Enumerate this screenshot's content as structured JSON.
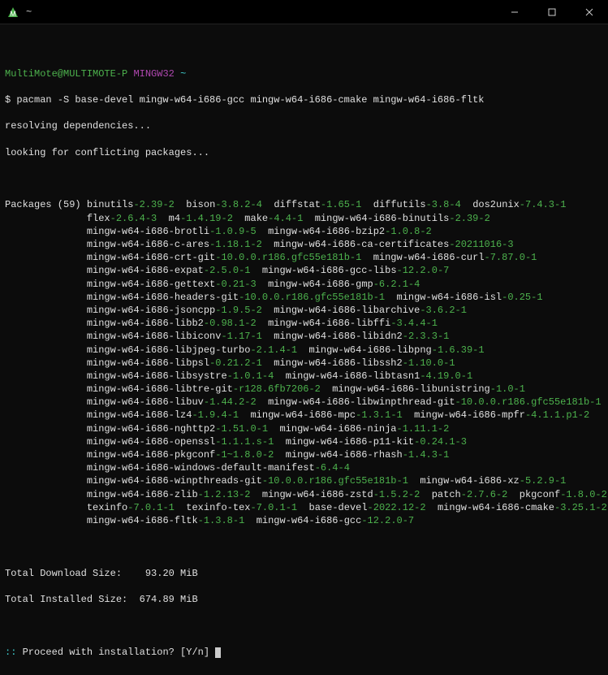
{
  "titlebar": {
    "title": "~"
  },
  "prompt": {
    "user": "MultiMote@MULTIMOTE-P",
    "env": "MINGW32",
    "tilde": "~",
    "dollar": "$",
    "command": "pacman -S base-devel mingw-w64-i686-gcc mingw-w64-i686-cmake mingw-w64-i686-fltk"
  },
  "lines": {
    "resolving": "resolving dependencies...",
    "looking": "looking for conflicting packages...",
    "packages_label": "Packages (59)",
    "total_dl_label": "Total Download Size:",
    "total_dl_val": "93.20 MiB",
    "total_inst_label": "Total Installed Size:",
    "total_inst_val": "674.89 MiB",
    "proceed_prefix": ":: ",
    "proceed_text": "Proceed with installation? [Y/n] "
  },
  "packages": [
    [
      [
        "binutils",
        "2.39-2"
      ],
      [
        "bison",
        "3.8.2-4"
      ],
      [
        "diffstat",
        "1.65-1"
      ],
      [
        "diffutils",
        "3.8-4"
      ],
      [
        "dos2unix",
        "7.4.3-1"
      ]
    ],
    [
      [
        "flex",
        "2.6.4-3"
      ],
      [
        "m4",
        "1.4.19-2"
      ],
      [
        "make",
        "4.4-1"
      ],
      [
        "mingw-w64-i686-binutils",
        "2.39-2"
      ]
    ],
    [
      [
        "mingw-w64-i686-brotli",
        "1.0.9-5"
      ],
      [
        "mingw-w64-i686-bzip2",
        "1.0.8-2"
      ]
    ],
    [
      [
        "mingw-w64-i686-c-ares",
        "1.18.1-2"
      ],
      [
        "mingw-w64-i686-ca-certificates",
        "20211016-3"
      ]
    ],
    [
      [
        "mingw-w64-i686-crt-git",
        "10.0.0.r186.gfc55e181b-1"
      ],
      [
        "mingw-w64-i686-curl",
        "7.87.0-1"
      ]
    ],
    [
      [
        "mingw-w64-i686-expat",
        "2.5.0-1"
      ],
      [
        "mingw-w64-i686-gcc-libs",
        "12.2.0-7"
      ]
    ],
    [
      [
        "mingw-w64-i686-gettext",
        "0.21-3"
      ],
      [
        "mingw-w64-i686-gmp",
        "6.2.1-4"
      ]
    ],
    [
      [
        "mingw-w64-i686-headers-git",
        "10.0.0.r186.gfc55e181b-1"
      ],
      [
        "mingw-w64-i686-isl",
        "0.25-1"
      ]
    ],
    [
      [
        "mingw-w64-i686-jsoncpp",
        "1.9.5-2"
      ],
      [
        "mingw-w64-i686-libarchive",
        "3.6.2-1"
      ]
    ],
    [
      [
        "mingw-w64-i686-libb2",
        "0.98.1-2"
      ],
      [
        "mingw-w64-i686-libffi",
        "3.4.4-1"
      ]
    ],
    [
      [
        "mingw-w64-i686-libiconv",
        "1.17-1"
      ],
      [
        "mingw-w64-i686-libidn2",
        "2.3.3-1"
      ]
    ],
    [
      [
        "mingw-w64-i686-libjpeg-turbo",
        "2.1.4-1"
      ],
      [
        "mingw-w64-i686-libpng",
        "1.6.39-1"
      ]
    ],
    [
      [
        "mingw-w64-i686-libpsl",
        "0.21.2-1"
      ],
      [
        "mingw-w64-i686-libssh2",
        "1.10.0-1"
      ]
    ],
    [
      [
        "mingw-w64-i686-libsystre",
        "1.0.1-4"
      ],
      [
        "mingw-w64-i686-libtasn1",
        "4.19.0-1"
      ]
    ],
    [
      [
        "mingw-w64-i686-libtre-git",
        "r128.6fb7206-2"
      ],
      [
        "mingw-w64-i686-libunistring",
        "1.0-1"
      ]
    ],
    [
      [
        "mingw-w64-i686-libuv",
        "1.44.2-2"
      ],
      [
        "mingw-w64-i686-libwinpthread-git",
        "10.0.0.r186.gfc55e181b-1"
      ]
    ],
    [
      [
        "mingw-w64-i686-lz4",
        "1.9.4-1"
      ],
      [
        "mingw-w64-i686-mpc",
        "1.3.1-1"
      ],
      [
        "mingw-w64-i686-mpfr",
        "4.1.1.p1-2"
      ]
    ],
    [
      [
        "mingw-w64-i686-nghttp2",
        "1.51.0-1"
      ],
      [
        "mingw-w64-i686-ninja",
        "1.11.1-2"
      ]
    ],
    [
      [
        "mingw-w64-i686-openssl",
        "1.1.1.s-1"
      ],
      [
        "mingw-w64-i686-p11-kit",
        "0.24.1-3"
      ]
    ],
    [
      [
        "mingw-w64-i686-pkgconf",
        "1~1.8.0-2"
      ],
      [
        "mingw-w64-i686-rhash",
        "1.4.3-1"
      ]
    ],
    [
      [
        "mingw-w64-i686-windows-default-manifest",
        "6.4-4"
      ]
    ],
    [
      [
        "mingw-w64-i686-winpthreads-git",
        "10.0.0.r186.gfc55e181b-1"
      ],
      [
        "mingw-w64-i686-xz",
        "5.2.9-1"
      ]
    ],
    [
      [
        "mingw-w64-i686-zlib",
        "1.2.13-2"
      ],
      [
        "mingw-w64-i686-zstd",
        "1.5.2-2"
      ],
      [
        "patch",
        "2.7.6-2"
      ],
      [
        "pkgconf",
        "1.8.0-2"
      ]
    ],
    [
      [
        "texinfo",
        "7.0.1-1"
      ],
      [
        "texinfo-tex",
        "7.0.1-1"
      ],
      [
        "base-devel",
        "2022.12-2"
      ],
      [
        "mingw-w64-i686-cmake",
        "3.25.1-2"
      ]
    ],
    [
      [
        "mingw-w64-i686-fltk",
        "1.3.8-1"
      ],
      [
        "mingw-w64-i686-gcc",
        "12.2.0-7"
      ]
    ]
  ]
}
